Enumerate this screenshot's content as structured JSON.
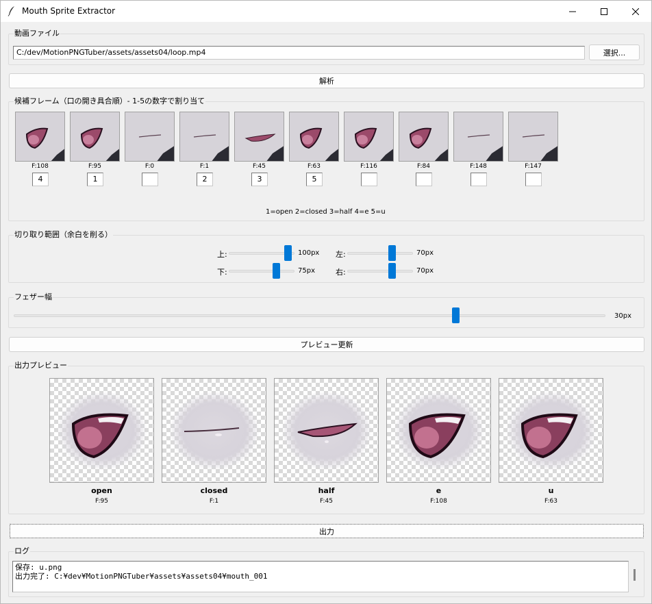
{
  "window": {
    "title": "Mouth Sprite Extractor"
  },
  "video": {
    "group_label": "動画ファイル",
    "path": "C:/dev/MotionPNGTuber/assets/assets04/loop.mp4",
    "select_label": "選択..."
  },
  "analyze_label": "解析",
  "candidates": {
    "group_label": "候補フレーム（口の開き具合順）- 1-5の数字で割り当て",
    "frames": [
      {
        "label": "F:108",
        "assign": "4",
        "mouth": "open-tilt"
      },
      {
        "label": "F:95",
        "assign": "1",
        "mouth": "open-tilt"
      },
      {
        "label": "F:0",
        "assign": "",
        "mouth": "closed"
      },
      {
        "label": "F:1",
        "assign": "2",
        "mouth": "closed"
      },
      {
        "label": "F:45",
        "assign": "3",
        "mouth": "half"
      },
      {
        "label": "F:63",
        "assign": "5",
        "mouth": "open-tilt"
      },
      {
        "label": "F:116",
        "assign": "",
        "mouth": "open-tilt"
      },
      {
        "label": "F:84",
        "assign": "",
        "mouth": "open-tilt"
      },
      {
        "label": "F:148",
        "assign": "",
        "mouth": "closed"
      },
      {
        "label": "F:147",
        "assign": "",
        "mouth": "closed"
      }
    ],
    "legend": "1=open  2=closed  3=half  4=e  5=u"
  },
  "crop": {
    "group_label": "切り取り範囲（余白を削る）",
    "top": {
      "label": "上:",
      "value": "100px",
      "level": 0.95
    },
    "bottom": {
      "label": "下:",
      "value": "75px",
      "level": 0.75
    },
    "left": {
      "label": "左:",
      "value": "70px",
      "level": 0.7
    },
    "right": {
      "label": "右:",
      "value": "70px",
      "level": 0.7
    }
  },
  "feather": {
    "group_label": "フェザー幅",
    "value": "30px",
    "level": 0.75
  },
  "preview_update_label": "プレビュー更新",
  "output_preview": {
    "group_label": "出力プレビュー",
    "items": [
      {
        "name": "open",
        "frame": "F:95",
        "mouth": "open-tilt"
      },
      {
        "name": "closed",
        "frame": "F:1",
        "mouth": "closed"
      },
      {
        "name": "half",
        "frame": "F:45",
        "mouth": "half"
      },
      {
        "name": "e",
        "frame": "F:108",
        "mouth": "open-tilt"
      },
      {
        "name": "u",
        "frame": "F:63",
        "mouth": "open-tilt"
      }
    ]
  },
  "output_label": "出力",
  "log": {
    "group_label": "ログ",
    "lines": [
      "保存: u.png",
      "出力完了: C:¥dev¥MotionPNGTuber¥assets¥assets04¥mouth_001"
    ]
  },
  "colors": {
    "accent": "#0078d7",
    "mouth_inner": "#8a3f5e",
    "mouth_dark": "#2a1020"
  }
}
